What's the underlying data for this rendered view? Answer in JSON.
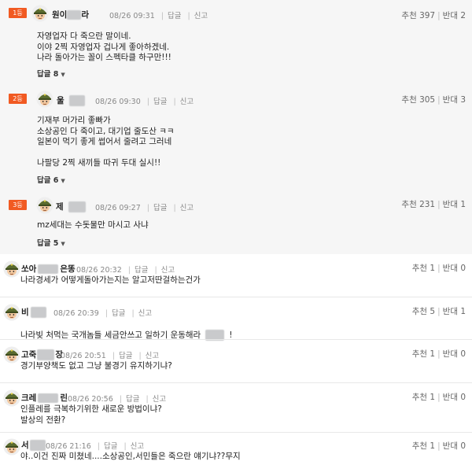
{
  "best_comments": [
    {
      "rank": "1등",
      "nick": "원이",
      "nick_tail": "라",
      "date": "08/26 09:31",
      "reply": "답글",
      "report": "신고",
      "recommend": "추천 397",
      "oppose": "반대 2",
      "body": "자영업자 다 죽으란 말이네.\n이야 2찍 자영업자 겁나게 좋아하겠네.\n나라 돌아가는 꼴이 스펙타클 하구만!!!",
      "reply_count": "답글 8"
    },
    {
      "rank": "2등",
      "nick": "울",
      "nick_tail": "",
      "date": "08/26 09:30",
      "reply": "답글",
      "report": "신고",
      "recommend": "추천 305",
      "oppose": "반대 3",
      "body": "기재부 머가리 좋빠가\n소상공인 다 죽이고, 대기업 줄도산 ㅋㅋ\n일본이 먹기 좋게 썹어서 줄려고 그러네\n\n나팔당 2찍 새끼들 따귀 두대 실시!!",
      "reply_count": "답글 6"
    },
    {
      "rank": "3등",
      "nick": "제",
      "nick_tail": "",
      "date": "08/26 09:27",
      "reply": "답글",
      "report": "신고",
      "recommend": "추천 231",
      "oppose": "반대 1",
      "body": "mz세대는 수돗물만 마시고 사냐",
      "reply_count": "답글 5"
    }
  ],
  "comments": [
    {
      "nick": "쏘아",
      "nick_tail": "은똥",
      "date": "08/26 20:32",
      "reply": "답글",
      "report": "신고",
      "recommend": "추천 1",
      "oppose": "반대 0",
      "body": "나라경세가 어떻게돌아가는지는 알고저딴걸하는건가"
    },
    {
      "nick": "비",
      "nick_tail": "",
      "date": "08/26 20:39",
      "reply": "답글",
      "report": "신고",
      "recommend": "추천 5",
      "oppose": "반대 1",
      "body": "나라빚 처먹는 국개놈들 세금안쓰고 일하기 운동해라",
      "body_tail": "!"
    },
    {
      "nick": "고죽",
      "nick_tail": "장",
      "date": "08/26 20:51",
      "reply": "답글",
      "report": "신고",
      "recommend": "추천 1",
      "oppose": "반대 0",
      "body": "경기부양책도 없고 그냥 불경기 유지하기냐?"
    },
    {
      "nick": "크레",
      "nick_tail": "린",
      "date": "08/26 20:56",
      "reply": "답글",
      "report": "신고",
      "recommend": "추천 1",
      "oppose": "반대 0",
      "body": "인플레를 극복하기위한 새로운 방법이냐?\n발상의 전환?"
    },
    {
      "nick": "서",
      "nick_tail": "",
      "date": "08/26 21:16",
      "reply": "답글",
      "report": "신고",
      "recommend": "추천 1",
      "oppose": "반대 0",
      "body": "야..이건 진짜 미쳤네....소상공인,서민들은 죽으란 얘기냐??무지"
    }
  ],
  "colors": {
    "rank_badge": "#f15a22",
    "best_background": "#f6f6f6",
    "avatar_face": "#f3c9a0",
    "avatar_helmet": "#5a6b2f"
  }
}
